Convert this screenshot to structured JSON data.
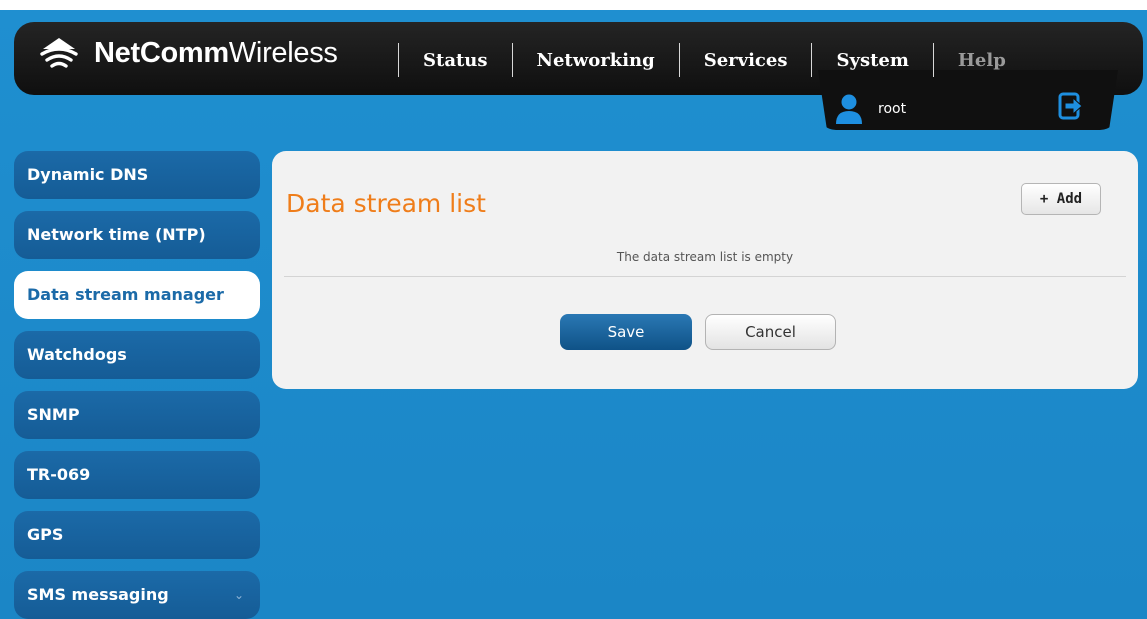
{
  "brand": {
    "bold": "NetComm",
    "light": "Wireless",
    "logo_icon": "wifi-icon"
  },
  "nav": {
    "status": "Status",
    "networking": "Networking",
    "services": "Services",
    "system": "System",
    "help": "Help"
  },
  "user": {
    "name": "root",
    "icon": "user-icon",
    "logout_icon": "logout-icon"
  },
  "sidebar": {
    "items": [
      {
        "label": "Dynamic DNS"
      },
      {
        "label": "Network time (NTP)"
      },
      {
        "label": "Data stream manager",
        "active": true
      },
      {
        "label": "Watchdogs"
      },
      {
        "label": "SNMP"
      },
      {
        "label": "TR-069"
      },
      {
        "label": "GPS"
      },
      {
        "label": "SMS messaging",
        "expandable": true
      }
    ]
  },
  "panel": {
    "title": "Data stream list",
    "add_label": "+ Add",
    "empty_message": "The data stream list is empty",
    "save_label": "Save",
    "cancel_label": "Cancel"
  },
  "colors": {
    "background": "#1f8fd0",
    "header": "#161616",
    "sidebar_item": "#1b6aa8",
    "title_accent": "#ef7d1a",
    "save_button": "#1a64a0"
  }
}
